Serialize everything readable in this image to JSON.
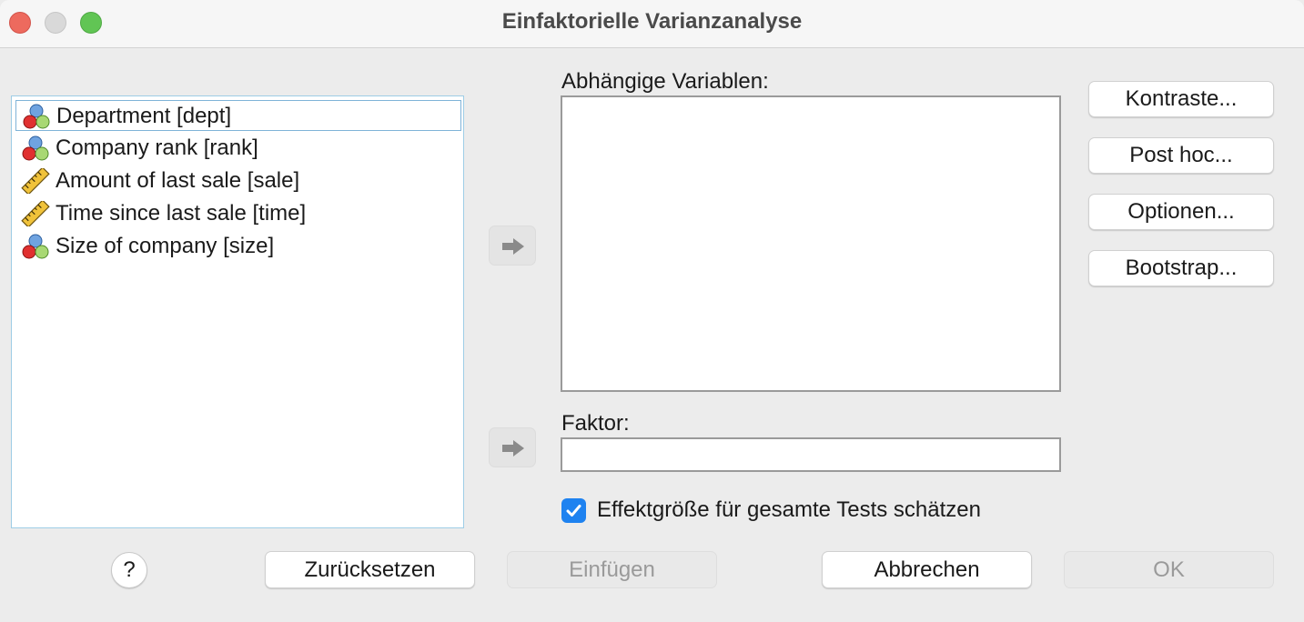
{
  "window": {
    "title": "Einfaktorielle Varianzanalyse"
  },
  "variables": [
    {
      "label": "Department [dept]",
      "icon": "nominal-icon",
      "selected": true
    },
    {
      "label": "Company rank [rank]",
      "icon": "nominal-icon",
      "selected": false
    },
    {
      "label": "Amount of last sale [sale]",
      "icon": "scale-ruler-icon",
      "selected": false
    },
    {
      "label": "Time since last sale [time]",
      "icon": "scale-ruler-icon",
      "selected": false
    },
    {
      "label": "Size of company [size]",
      "icon": "nominal-icon",
      "selected": false
    }
  ],
  "dependent": {
    "label": "Abhängige Variablen:"
  },
  "factor": {
    "label": "Faktor:"
  },
  "side_buttons": {
    "contrasts": "Kontraste...",
    "post_hoc": "Post hoc...",
    "options": "Optionen...",
    "bootstrap": "Bootstrap..."
  },
  "effect_size": {
    "label": "Effektgröße für gesamte Tests schätzen",
    "checked": true
  },
  "footer": {
    "help": "?",
    "reset": "Zurücksetzen",
    "paste": "Einfügen",
    "cancel": "Abbrechen",
    "ok": "OK"
  },
  "colors": {
    "accent": "#1e82f0",
    "list_border": "#9ecde6"
  }
}
